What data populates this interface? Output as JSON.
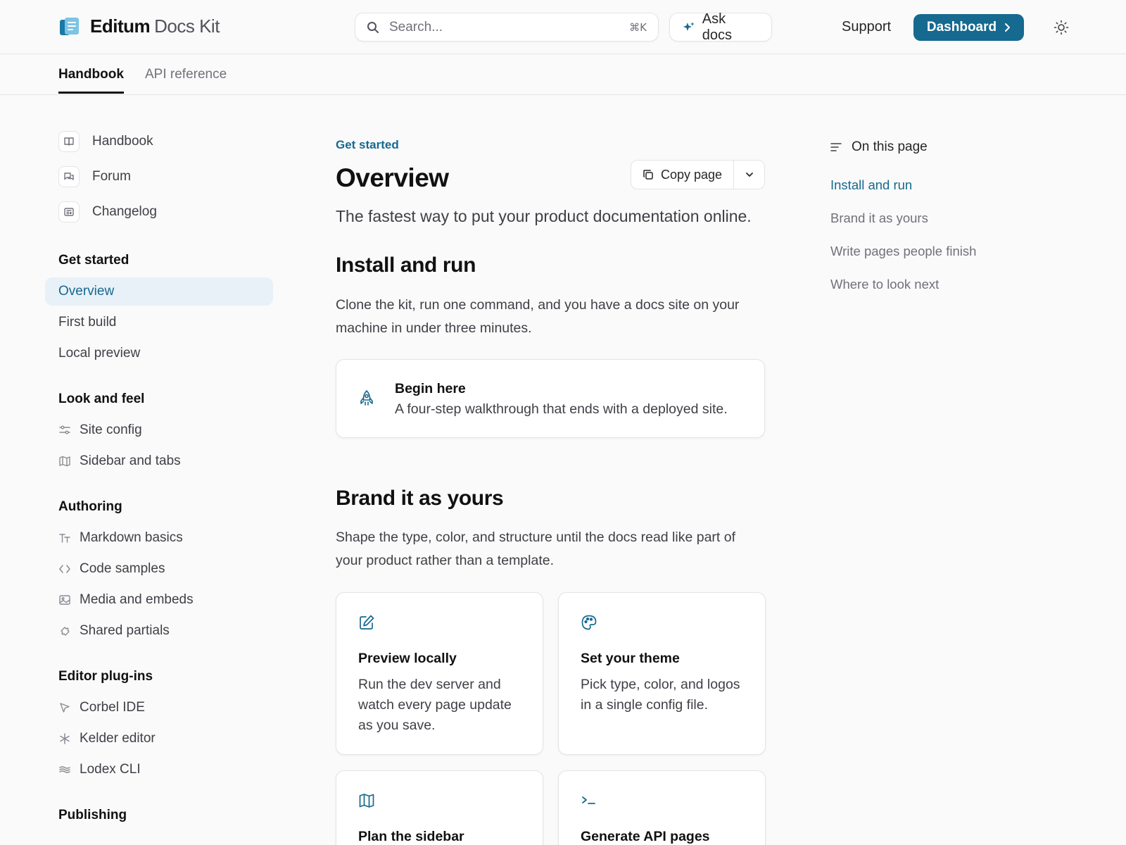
{
  "header": {
    "brand": "Editum",
    "product": "Docs Kit",
    "search": {
      "placeholder": "Search...",
      "shortcut": "⌘K"
    },
    "ask_label": "Ask docs",
    "support_label": "Support",
    "dashboard_label": "Dashboard"
  },
  "tabs": [
    {
      "label": "Handbook",
      "active": true
    },
    {
      "label": "API reference",
      "active": false
    }
  ],
  "sidebar": {
    "quick_links": [
      {
        "label": "Handbook",
        "icon": "book-icon"
      },
      {
        "label": "Forum",
        "icon": "chat-icon"
      },
      {
        "label": "Changelog",
        "icon": "newspaper-icon"
      }
    ],
    "groups": [
      {
        "title": "Get started",
        "items": [
          {
            "label": "Overview",
            "active": true
          },
          {
            "label": "First build"
          },
          {
            "label": "Local preview"
          }
        ]
      },
      {
        "title": "Look and feel",
        "items": [
          {
            "label": "Site config",
            "icon": "sliders-icon"
          },
          {
            "label": "Sidebar and tabs",
            "icon": "map-icon"
          }
        ]
      },
      {
        "title": "Authoring",
        "items": [
          {
            "label": "Markdown basics",
            "icon": "text-size-icon"
          },
          {
            "label": "Code samples",
            "icon": "code-icon"
          },
          {
            "label": "Media and embeds",
            "icon": "image-icon"
          },
          {
            "label": "Shared partials",
            "icon": "puzzle-icon"
          }
        ]
      },
      {
        "title": "Editor plug-ins",
        "items": [
          {
            "label": "Corbel IDE",
            "icon": "cursor-icon"
          },
          {
            "label": "Kelder editor",
            "icon": "asterisk-icon"
          },
          {
            "label": "Lodex CLI",
            "icon": "waves-icon"
          }
        ]
      },
      {
        "title": "Publishing",
        "items": []
      }
    ]
  },
  "main": {
    "eyebrow": "Get started",
    "title": "Overview",
    "copy_label": "Copy page",
    "subtitle": "The fastest way to put your product documentation online.",
    "sections": [
      {
        "heading": "Install and run",
        "body_lines": [
          "Clone the kit, run one command, and you have a docs site on your",
          "machine in under three minutes."
        ]
      },
      {
        "heading": "Brand it as yours",
        "body_lines": [
          "Shape the type, color, and structure until the docs read like part of",
          "your product rather than a template."
        ]
      }
    ],
    "callout": {
      "title": "Begin here",
      "description": "A four-step walkthrough that ends with a deployed site."
    },
    "cards": [
      {
        "title": "Preview locally",
        "description": "Run the dev server and watch every page update as you save.",
        "icon": "edit-icon"
      },
      {
        "title": "Set your theme",
        "description": "Pick type, color, and logos in a single config file.",
        "icon": "palette-icon"
      },
      {
        "title": "Plan the sidebar",
        "description": "",
        "icon": "map-icon"
      },
      {
        "title": "Generate API pages",
        "description": "",
        "icon": "terminal-icon"
      }
    ]
  },
  "toc": {
    "heading": "On this page",
    "items": [
      {
        "label": "Install and run",
        "active": true
      },
      {
        "label": "Brand it as yours"
      },
      {
        "label": "Write pages people finish"
      },
      {
        "label": "Where to look next"
      }
    ]
  },
  "colors": {
    "accent": "#16698f",
    "active_bg": "#e8f1f8",
    "border": "#e4e4e7"
  }
}
